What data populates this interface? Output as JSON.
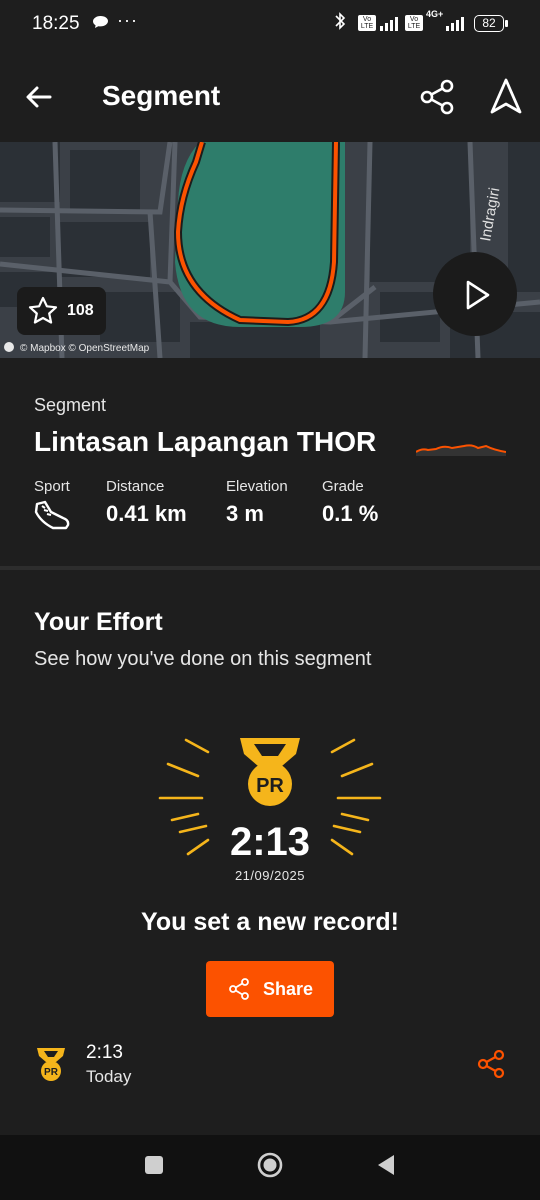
{
  "status_bar": {
    "time": "18:25",
    "dots": "···",
    "sim1_label": "Vo LTE",
    "sim2_label": "Vo LTE",
    "network_type": "4G+",
    "battery": "82"
  },
  "header": {
    "title": "Segment",
    "back_icon": "arrow-left-icon",
    "share_icon": "share-icon",
    "navigate_icon": "navigation-arrow-icon"
  },
  "map": {
    "street_label": "Indragiri",
    "star_count": "108",
    "attribution": "© Mapbox © OpenStreetMap",
    "route_color": "#fc5200",
    "field_color": "#2e7d6b"
  },
  "segment": {
    "label": "Segment",
    "name": "Lintasan Lapangan THOR",
    "stats": {
      "sport_label": "Sport",
      "sport_icon": "running-shoe-icon",
      "distance_label": "Distance",
      "distance_value": "0.41 km",
      "elevation_label": "Elevation",
      "elevation_value": "3 m",
      "grade_label": "Grade",
      "grade_value": "0.1 %"
    }
  },
  "effort": {
    "title": "Your Effort",
    "subtitle": "See how you've done on this segment",
    "badge_text": "PR",
    "time": "2:13",
    "date": "21/09/2025",
    "message": "You set a new record!",
    "share_label": "Share",
    "history": [
      {
        "badge": "PR",
        "time": "2:13",
        "day": "Today"
      }
    ]
  },
  "colors": {
    "accent": "#fc5200",
    "medal": "#f5b51b",
    "background": "#1e1e1e"
  },
  "nav": {
    "recents_icon": "square-recents-icon",
    "home_icon": "circle-home-icon",
    "back_icon": "triangle-back-icon"
  }
}
